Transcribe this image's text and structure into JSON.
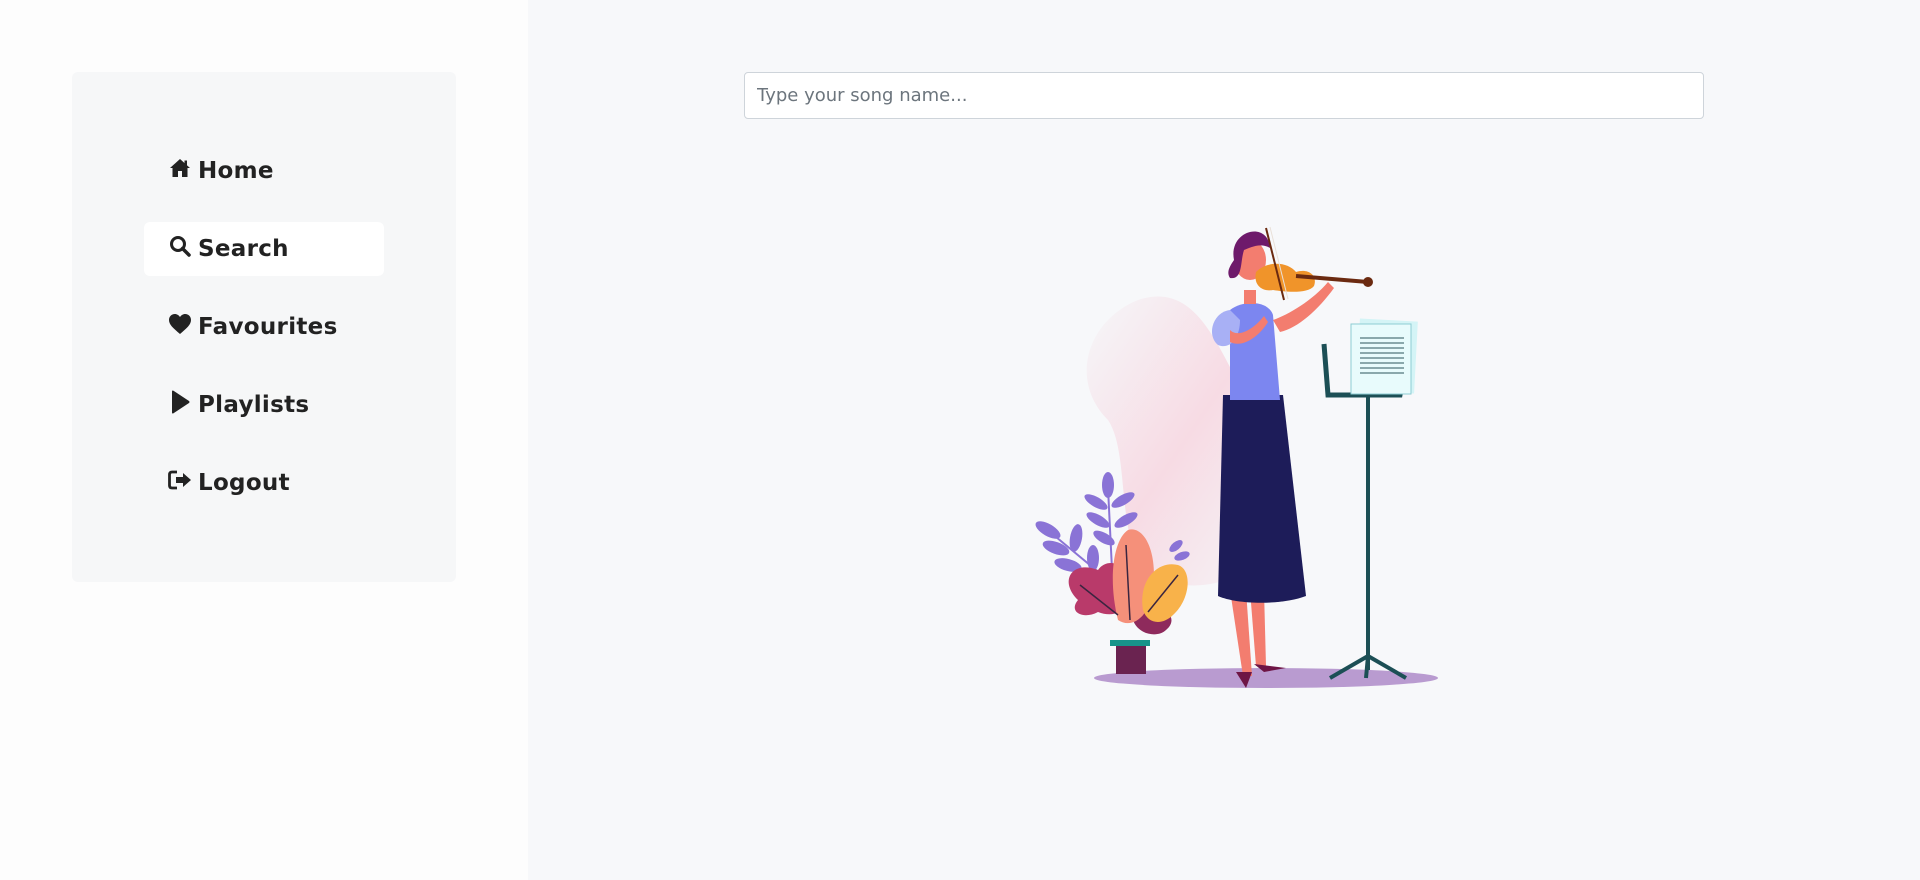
{
  "sidebar": {
    "items": [
      {
        "label": "Home",
        "icon": "home-icon",
        "active": false
      },
      {
        "label": "Search",
        "icon": "search-icon",
        "active": true
      },
      {
        "label": "Favourites",
        "icon": "heart-icon",
        "active": false
      },
      {
        "label": "Playlists",
        "icon": "play-icon",
        "active": false
      },
      {
        "label": "Logout",
        "icon": "logout-icon",
        "active": false
      }
    ]
  },
  "search": {
    "placeholder": "Type your song name...",
    "value": ""
  },
  "illustration": {
    "subject": "violinist-illustration"
  },
  "colors": {
    "page_bg": "#f7f8fa",
    "sidebar_bg": "#f6f7f8",
    "active_item_bg": "#ffffff",
    "text": "#222222"
  }
}
